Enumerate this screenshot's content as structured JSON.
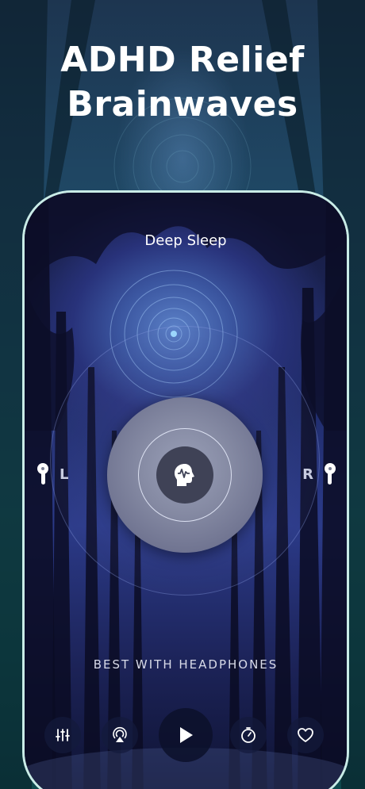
{
  "headline": {
    "line1": "ADHD Relief",
    "line2": "Brainwaves"
  },
  "player": {
    "track_title": "Deep Sleep",
    "left_label": "L",
    "right_label": "R",
    "hint": "BEST WITH HEADPHONES"
  },
  "controls": [
    {
      "name": "equalizer-icon"
    },
    {
      "name": "airplay-icon"
    },
    {
      "name": "play-icon"
    },
    {
      "name": "timer-icon"
    },
    {
      "name": "heart-icon"
    }
  ],
  "colors": {
    "frame_border": "#c9ece7",
    "text": "#ffffff",
    "disc": "#858aa3",
    "disc_center": "#3f4256"
  }
}
